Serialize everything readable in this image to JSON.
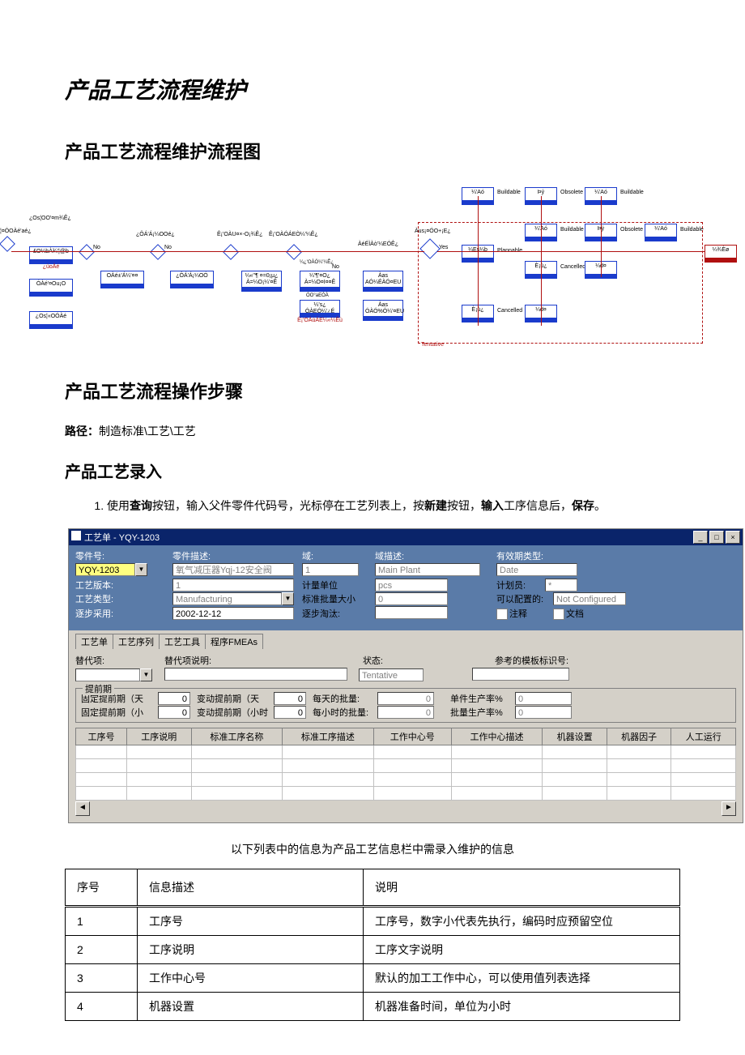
{
  "title_main": "产品工艺流程维护",
  "h2_flowchart": "产品工艺流程维护流程图",
  "h2_steps": "产品工艺流程操作步骤",
  "path_label": "路径：",
  "path_text": "制造标准\\工艺\\工艺",
  "h3_entry": "产品工艺录入",
  "step1": {
    "prefix": "使用",
    "b1": "查询",
    "t1": "按钮，输入父件零件代码号，光标停在工艺列表上，按",
    "b2": "新建",
    "t2": "按钮，",
    "b3": "输入",
    "t3": "工序信息后，",
    "b4": "保存",
    "t4": "。"
  },
  "flow": {
    "tentative": "Tentative",
    "label_no": "No",
    "label_yes": "Yes",
    "tag_buildable": "Buildable",
    "tag_obsolete": "Obsolete",
    "tag_plannable": "Plannable",
    "tag_cancelled": "Cancelled"
  },
  "ss": {
    "title": "工艺单 - YQY-1203",
    "min": "_",
    "max": "□",
    "close": "×",
    "r1": {
      "l1": "零件号:",
      "v1": "YQY-1203",
      "l2": "零件描述:",
      "v2": "氧气减压器Yqj-12安全阀",
      "l3": "域:",
      "v3": "1",
      "l4": "域描述:",
      "v4": "Main Plant",
      "l5": "有效期类型:",
      "v5": "Date"
    },
    "r2": {
      "l1": "工艺版本:",
      "v1": "1",
      "l2": "计量单位",
      "v2": "pcs",
      "l3": "计划员:",
      "v3": "*"
    },
    "r3": {
      "l1": "工艺类型:",
      "v1": "Manufacturing",
      "l2": "标准批量大小",
      "v2": "0",
      "l3": "可以配置的:",
      "v3": "Not Configured"
    },
    "r4": {
      "l1": "逐步采用:",
      "v1": "2002-12-12",
      "l2": "逐步淘汰:",
      "v2": "",
      "l3": "注释",
      "l4": "文档"
    },
    "tabs": [
      "工艺单",
      "工艺序列",
      "工艺工具",
      "程序FMEAs"
    ],
    "sect1": {
      "l1": "替代项:",
      "l2": "替代项说明:",
      "l3": "状态:",
      "v3": "Tentative",
      "l4": "参考的模板标识号:"
    },
    "fs_title": "提前期",
    "sect2a": {
      "l1": "固定提前期（天",
      "v1": "0",
      "l2": "变动提前期（天",
      "v2": "0",
      "l3": "每天的批量:",
      "v3": "0",
      "l4": "单件生产率%",
      "v4": "0"
    },
    "sect2b": {
      "l1": "固定提前期（小",
      "v1": "0",
      "l2": "变动提前期（小时",
      "v2": "0",
      "l3": "每小时的批量:",
      "v3": "0",
      "l4": "批量生产率%",
      "v4": "0"
    },
    "cols": [
      "工序号",
      "工序说明",
      "标准工序名称",
      "标准工序描述",
      "工作中心号",
      "工作中心描述",
      "机器设置",
      "机器因子",
      "人工运行"
    ],
    "sb_left": "◄",
    "sb_right": "►"
  },
  "caption": "以下列表中的信息为产品工艺信息栏中需录入维护的信息",
  "info_headers": [
    "序号",
    "信息描述",
    "说明"
  ],
  "info_rows": [
    [
      "1",
      "工序号",
      "工序号，数字小代表先执行，编码时应预留空位"
    ],
    [
      "2",
      "工序说明",
      "工序文字说明"
    ],
    [
      "3",
      "工作中心号",
      "默认的加工工作中心，可以使用值列表选择"
    ],
    [
      "4",
      "机器设置",
      "机器准备时间，单位为小时"
    ]
  ]
}
